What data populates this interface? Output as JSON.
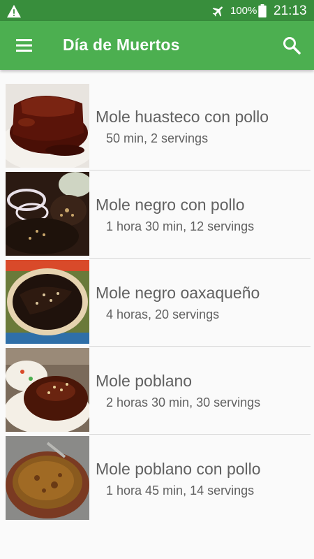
{
  "status_bar": {
    "battery_percent": "100%",
    "time": "21:13",
    "icons": [
      "warning-icon",
      "airplane-mode-icon",
      "battery-icon"
    ]
  },
  "app_bar": {
    "title": "Día de Muertos",
    "icons": [
      "menu-icon",
      "search-icon"
    ]
  },
  "recipes": [
    {
      "title": "Mole huasteco con pollo",
      "details": "50 min, 2 servings"
    },
    {
      "title": "Mole negro con pollo",
      "details": "1 hora 30 min, 12 servings"
    },
    {
      "title": "Mole negro oaxaqueño",
      "details": "4 horas, 20 servings"
    },
    {
      "title": "Mole poblano",
      "details": "2 horas 30 min, 30 servings"
    },
    {
      "title": "Mole poblano con pollo",
      "details": "1 hora 45 min, 14 servings"
    }
  ],
  "colors": {
    "status_bar": "#388e3c",
    "app_bar": "#4caf50",
    "background": "#fafafa",
    "text": "#616161"
  }
}
